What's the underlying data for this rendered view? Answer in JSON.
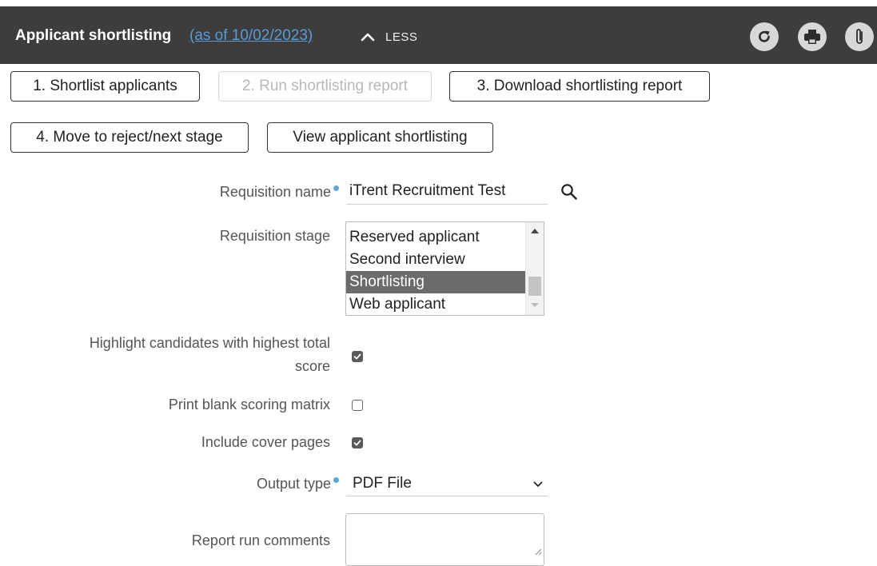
{
  "header": {
    "title": "Applicant shortlisting",
    "as_of": "(as of 10/02/2023)",
    "toggle_label": "LESS",
    "icons": [
      "refresh-icon",
      "print-icon",
      "paperclip-icon"
    ]
  },
  "toolbar": {
    "buttons": [
      {
        "label": "1. Shortlist applicants",
        "enabled": true
      },
      {
        "label": "2. Run shortlisting report",
        "enabled": false
      },
      {
        "label": "3. Download shortlisting report",
        "enabled": true
      },
      {
        "label": "4. Move to reject/next stage",
        "enabled": true
      },
      {
        "label": "View applicant shortlisting",
        "enabled": true
      }
    ]
  },
  "form": {
    "requisition_name": {
      "label": "Requisition name",
      "required": true,
      "value": "iTrent Recruitment Test"
    },
    "requisition_stage": {
      "label": "Requisition stage",
      "options": [
        "Reserved applicant",
        "Second interview",
        "Shortlisting",
        "Web applicant"
      ],
      "selected": "Shortlisting"
    },
    "highlight_candidates": {
      "label_line1": "Highlight candidates with highest total",
      "label_line2": "score",
      "checked": true
    },
    "print_blank_matrix": {
      "label": "Print blank scoring matrix",
      "checked": false
    },
    "include_cover_pages": {
      "label": "Include cover pages",
      "checked": true
    },
    "output_type": {
      "label": "Output type",
      "required": true,
      "value": "PDF File"
    },
    "report_run_comments": {
      "label": "Report run comments",
      "value": ""
    }
  },
  "colors": {
    "header_bg": "#3d3d3d",
    "link": "#5b9bd5",
    "required_dot": "#5ba7d8",
    "selected_row": "#6b6b6b"
  }
}
